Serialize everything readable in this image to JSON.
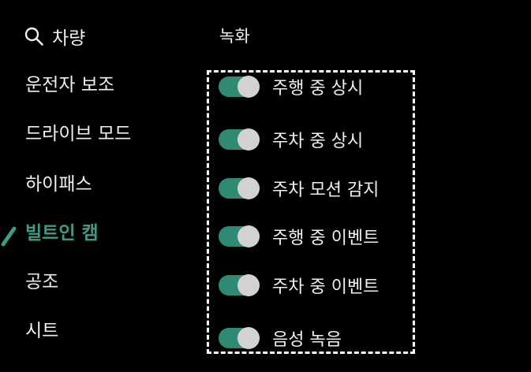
{
  "sidebar": {
    "search": {
      "label": "차량",
      "icon": "search-icon"
    },
    "items": [
      {
        "label": "운전자 보조",
        "active": false
      },
      {
        "label": "드라이브 모드",
        "active": false
      },
      {
        "label": "하이패스",
        "active": false
      },
      {
        "label": "빌트인 캠",
        "active": true
      },
      {
        "label": "공조",
        "active": false
      },
      {
        "label": "시트",
        "active": false
      }
    ]
  },
  "main": {
    "section_title": "녹화",
    "toggles": [
      {
        "label": "주행 중 상시",
        "on": true
      },
      {
        "label": "주차 중 상시",
        "on": true
      },
      {
        "label": "주차 모션 감지",
        "on": true
      },
      {
        "label": "주행 중 이벤트",
        "on": true
      },
      {
        "label": "주차 중 이벤트",
        "on": true
      },
      {
        "label": "음성 녹음",
        "on": true
      }
    ]
  },
  "colors": {
    "background": "#000000",
    "accent": "#3d9b86",
    "toggle_track": "#2f8a73",
    "toggle_knob": "#d2d2d2",
    "text": "#f0f0f0"
  }
}
